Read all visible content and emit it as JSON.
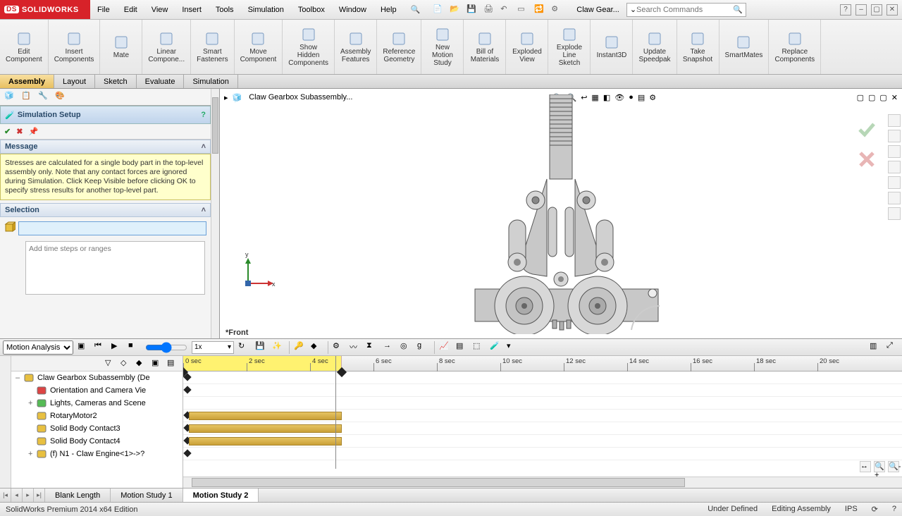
{
  "app": {
    "brand": "SOLIDWORKS"
  },
  "menu": [
    "File",
    "Edit",
    "View",
    "Insert",
    "Tools",
    "Simulation",
    "Toolbox",
    "Window",
    "Help"
  ],
  "doc_title": "Claw Gear...",
  "search_placeholder": "Search Commands",
  "ribbon": [
    {
      "label": "Edit\nComponent"
    },
    {
      "label": "Insert\nComponents"
    },
    {
      "label": "Mate"
    },
    {
      "label": "Linear\nCompone..."
    },
    {
      "label": "Smart\nFasteners"
    },
    {
      "label": "Move\nComponent"
    },
    {
      "label": "Show\nHidden\nComponents"
    },
    {
      "label": "Assembly\nFeatures"
    },
    {
      "label": "Reference\nGeometry"
    },
    {
      "label": "New\nMotion\nStudy"
    },
    {
      "label": "Bill of\nMaterials"
    },
    {
      "label": "Exploded\nView"
    },
    {
      "label": "Explode\nLine\nSketch"
    },
    {
      "label": "Instant3D"
    },
    {
      "label": "Update\nSpeedpak"
    },
    {
      "label": "Take\nSnapshot"
    },
    {
      "label": "SmartMates"
    },
    {
      "label": "Replace\nComponents"
    }
  ],
  "tabs": [
    "Assembly",
    "Layout",
    "Sketch",
    "Evaluate",
    "Simulation"
  ],
  "active_tab": "Assembly",
  "breadcrumb": "Claw Gearbox Subassembly...",
  "panel": {
    "title": "Simulation Setup",
    "message_head": "Message",
    "message_body": "Stresses are calculated for a single body part in the top-level assembly only. Note that any contact forces are ignored during Simulation. Click Keep Visible before clicking OK to specify stress results for another top-level part.",
    "selection_head": "Selection",
    "ranges_placeholder": "Add time steps or ranges"
  },
  "view_label": "*Front",
  "triad": {
    "x": "x",
    "y": "y"
  },
  "motion": {
    "type_label": "Motion Analysis",
    "speed_value": "1x",
    "ruler_labels": [
      "0 sec",
      "2 sec",
      "4 sec",
      "6 sec",
      "8 sec",
      "10 sec",
      "12 sec",
      "14 sec",
      "16 sec",
      "18 sec",
      "20 sec"
    ],
    "tree": [
      {
        "label": "Claw Gearbox Subassembly  (De",
        "indent": 0,
        "exp": "–",
        "icon": "asm"
      },
      {
        "label": "Orientation and Camera Vie",
        "indent": 1,
        "exp": "",
        "icon": "cam"
      },
      {
        "label": "Lights, Cameras and Scene",
        "indent": 1,
        "exp": "+",
        "icon": "light"
      },
      {
        "label": "RotaryMotor2",
        "indent": 1,
        "exp": "",
        "icon": "motor"
      },
      {
        "label": "Solid Body Contact3",
        "indent": 1,
        "exp": "",
        "icon": "contact"
      },
      {
        "label": "Solid Body Contact4",
        "indent": 1,
        "exp": "",
        "icon": "contact"
      },
      {
        "label": "(f) N1 - Claw Engine<1>->? ",
        "indent": 1,
        "exp": "+",
        "icon": "part"
      }
    ],
    "bar_rows": [
      3,
      4,
      5
    ],
    "key_rows": [
      0,
      1,
      3,
      4,
      5,
      6
    ],
    "end_row": 0,
    "playhead_sec": 4.8,
    "selected_end_sec": 5.0
  },
  "bottom_tabs": [
    "Blank Length",
    "Motion Study 1",
    "Motion Study 2"
  ],
  "active_bottom_tab": "Motion Study 2",
  "status": {
    "left": "SolidWorks Premium 2014 x64 Edition",
    "mid": "Under Defined",
    "right": "Editing Assembly",
    "units": "IPS"
  }
}
